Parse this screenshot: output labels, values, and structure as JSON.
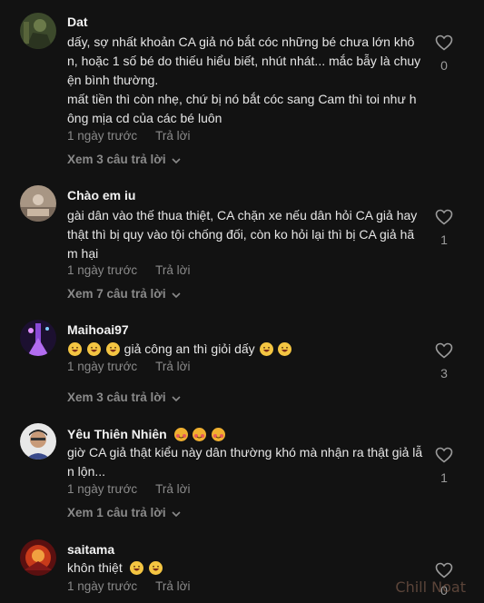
{
  "comments": [
    {
      "username": "Dat",
      "lines": [
        "dấy, sợ nhất khoản CA giả nó bắt cóc những bé chưa lớn khôn, hoặc 1 số bé do thiếu hiểu biết, nhút nhát... mắc bẫy là chuyện bình thường.",
        "mất tiền thì còn nhẹ, chứ bị nó bắt cóc sang Cam thì toi như hông mịa cd của các bé luôn"
      ],
      "time": "1 ngày trước",
      "reply": "Trả lời",
      "view_replies": "Xem 3 câu trả lời",
      "likes": "0"
    },
    {
      "username": "Chào em iu",
      "lines": [
        "gài dân vào thế thua thiệt, CA chặn xe nếu dân hỏi CA giả hay thật thì bị quy vào tội chống đối, còn ko hỏi lại thì bị CA giả hãm hại"
      ],
      "time": "1 ngày trước",
      "reply": "Trả lời",
      "view_replies": "Xem 7 câu trả lời",
      "likes": "1"
    },
    {
      "username": "Maihoai97",
      "text_before": "",
      "text_main": "giả công an thì giỏi dấy",
      "time": "1 ngày trước",
      "reply": "Trả lời",
      "view_replies": "Xem 3 câu trả lời",
      "likes": "3"
    },
    {
      "username": "Yêu Thiên Nhiên",
      "lines": [
        "giờ CA giả thật kiểu này dân thường khó mà nhận ra thật giả lẫn lộn..."
      ],
      "time": "1 ngày trước",
      "reply": "Trả lời",
      "view_replies": "Xem 1 câu trả lời",
      "likes": "1"
    },
    {
      "username": "saitama",
      "text_main": "khôn thiệt",
      "time": "1 ngày trước",
      "reply": "Trả lời",
      "likes": "0"
    }
  ],
  "watermark": "Chill Noat",
  "icons": {
    "like": "heart-outline-icon",
    "expand": "chevron-down-icon"
  },
  "colors": {
    "background": "#121212",
    "muted": "#8a8a8a",
    "text": "#e6e6e6"
  }
}
